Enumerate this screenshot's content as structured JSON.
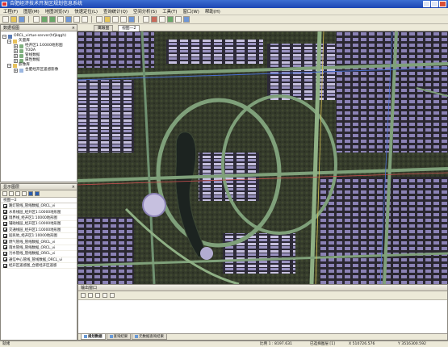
{
  "app": {
    "title": "合肥经济技术开发区规划信息系统"
  },
  "menu": [
    "工程(F)",
    "图层(M)",
    "地图浏览(V)",
    "快速定位(L)",
    "查询统计(Q)",
    "空间分析(S)",
    "工具(T)",
    "窗口(W)",
    "帮助(H)"
  ],
  "data_panel": {
    "title": "数据视图",
    "close": "×",
    "tree": {
      "server": "ORCL_virtue-server(hfjkqgh)",
      "vector_group": "矢量库",
      "vector_items": [
        "经开区1:10000地形图",
        "TODA",
        "管线数据",
        "属性数据"
      ],
      "imagery_group": "影像库",
      "imagery_items": [
        "合肥经开区遥感影像"
      ]
    }
  },
  "display_panel": {
    "title": "显示图层",
    "close": "×",
    "view_label": "视图一2",
    "layers": [
      "路灯管线_管线数据_ORCL_vi",
      "水系线层_经开区1:10000地形图",
      "境界线_经开区1:10000地形图",
      "辅助线层_经开区1:10000地形图",
      "交通线层_经开区1:10000地形图",
      "居民地_经开区1:10000地形图",
      "燃气管线_管线数据_ORCL_vi",
      "雨水管线_管线数据_ORCL_vi",
      "污水管线_管线数据_ORCL_vi",
      "通信中心管线_管线数据_ORCL_vi",
      "经开区遥感图_合肥经开区遥感"
    ]
  },
  "map_tabs": {
    "tab1": "鹰眼图",
    "tab2": "视图一2"
  },
  "output": {
    "title": "输出窗口",
    "tabs": [
      "规划数据",
      "查询结果",
      "元数据查询结果"
    ]
  },
  "status": {
    "ready": "就绪",
    "scale": "比例 1 : 8197.631",
    "selected": "已选择图层 [1]",
    "x": "X  510726.576",
    "y": "Y  3516300.592"
  },
  "colors": {
    "title_bg": "#1c46b3",
    "panel_bg": "#ece9d8",
    "map_bg": "#2a2e27",
    "road": "#7fa07a",
    "building": "#bcb6d6"
  }
}
